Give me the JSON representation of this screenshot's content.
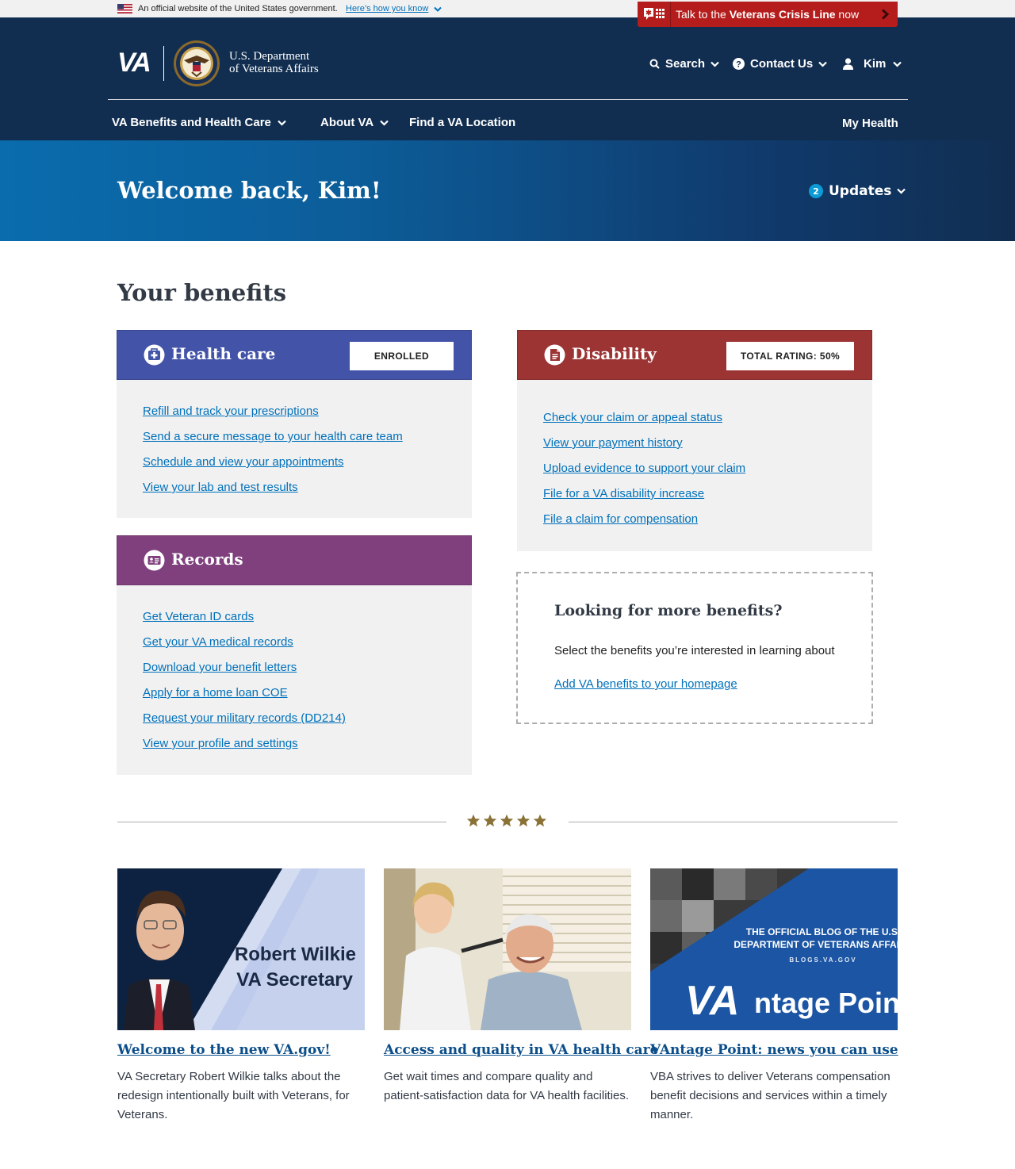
{
  "gov_banner": {
    "text": "An official website of the United States government.",
    "link": "Here’s how you know"
  },
  "crisis_line": {
    "prefix": "Talk to the ",
    "bold": "Veterans Crisis Line",
    "suffix": " now"
  },
  "header": {
    "logo": "VA",
    "dept_line1": "U.S. Department",
    "dept_line2": "of Veterans Affairs",
    "search": "Search",
    "contact": "Contact Us",
    "user": "Kim"
  },
  "menu": {
    "benefits": "VA Benefits and Health Care",
    "about": "About VA",
    "find": "Find a VA Location",
    "my_health": "My Health"
  },
  "hero": {
    "title": "Welcome back, Kim!",
    "updates_count": "2",
    "updates_label": "Updates"
  },
  "section_title": "Your benefits",
  "health_card": {
    "title": "Health care",
    "badge": "ENROLLED",
    "color": "#4354a8",
    "links": [
      "Refill and track your prescriptions",
      "Send a secure message to your health care team",
      "Schedule and view your appointments",
      "View your lab and test results"
    ]
  },
  "records_card": {
    "title": "Records",
    "color": "#80407e",
    "links": [
      "Get Veteran ID cards",
      "Get your VA medical records",
      "Download your benefit letters",
      "Apply for a home loan COE",
      "Request your military records (DD214)",
      "View your profile and settings"
    ]
  },
  "disability_card": {
    "title": "Disability",
    "badge": "TOTAL RATING: 50%",
    "color": "#9c3434",
    "links": [
      "Check your claim or appeal status",
      "View your payment history",
      "Upload evidence to support your claim",
      "File for a VA disability increase",
      "File a claim for compensation"
    ]
  },
  "more_benefits": {
    "title": "Looking for more benefits?",
    "text": "Select the benefits you’re interested in learning about",
    "link": "Add VA benefits to your homepage"
  },
  "promos": [
    {
      "image_line1": "Robert Wilkie",
      "image_line2": "VA Secretary",
      "title": "Welcome to the new VA.gov!",
      "desc": "VA Secretary Robert Wilkie talks about the redesign intentionally built with Veterans, for Veterans."
    },
    {
      "title": "Access and quality in VA health care",
      "desc": "Get wait times and compare quality and patient-satisfaction data for VA health facilities."
    },
    {
      "image_line1": "THE OFFICIAL BLOG OF THE U.S.",
      "image_line2": "DEPARTMENT OF VETERANS AFFAIRS",
      "image_line3": "BLOGS.VA.GOV",
      "image_logo_va": "VA",
      "image_logo_rest": "ntage Point",
      "title": "VAntage Point: news you can use",
      "desc": "VBA strives to deliver Veterans compensation benefit decisions and services within a timely manner."
    }
  ],
  "colors": {
    "header_bg": "#112e51",
    "link": "#0071bb",
    "crisis_red": "#b51c1c",
    "star_gold": "#8a7237"
  }
}
